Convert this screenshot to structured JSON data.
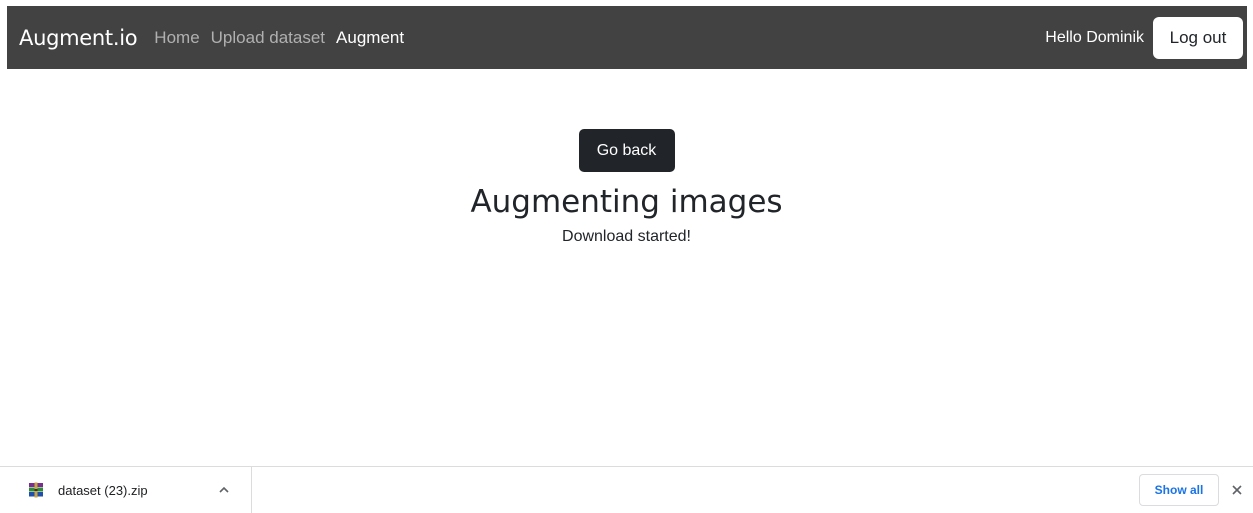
{
  "navbar": {
    "brand": "Augment.io",
    "links": [
      {
        "label": "Home",
        "active": false
      },
      {
        "label": "Upload dataset",
        "active": false
      },
      {
        "label": "Augment",
        "active": true
      }
    ],
    "greeting": "Hello Dominik",
    "logout_label": "Log out"
  },
  "main": {
    "back_label": "Go back",
    "title": "Augmenting images",
    "status": "Download started!"
  },
  "download_shelf": {
    "file_name": "dataset (23).zip",
    "file_icon": "winrar-archive-icon",
    "expand_icon": "chevron-up-icon",
    "show_all_label": "Show all",
    "close_icon": "close-icon"
  },
  "colors": {
    "navbar_bg": "#424242",
    "dark_button": "#212529",
    "link_blue": "#1a73e8"
  }
}
